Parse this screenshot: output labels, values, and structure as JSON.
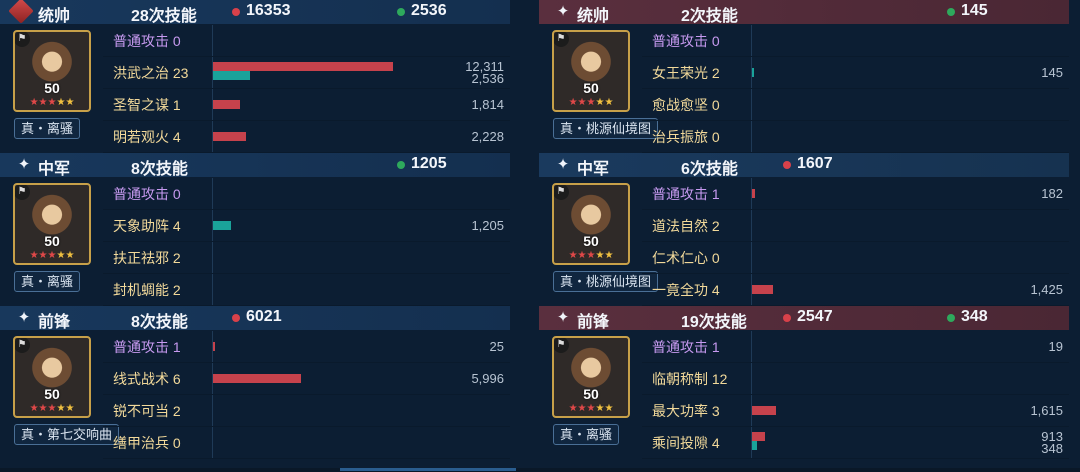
{
  "left": [
    {
      "role": "统帅",
      "icon": "red-diamond-badge-icon",
      "skill_count": "28次技能",
      "damage": "16353",
      "heal": "2536",
      "level": "50",
      "hero": "真・离骚",
      "skills": [
        {
          "name": "普通攻击",
          "count": "0",
          "basic": true,
          "bars": [],
          "values": []
        },
        {
          "name": "洪武之治",
          "count": "23",
          "basic": false,
          "bars": [
            {
              "kind": "damage",
              "value": 12311
            },
            {
              "kind": "heal",
              "value": 2536
            }
          ],
          "values": [
            "12,311",
            "2,536"
          ]
        },
        {
          "name": "圣智之谋",
          "count": "1",
          "basic": false,
          "bars": [
            {
              "kind": "damage",
              "value": 1814
            }
          ],
          "values": [
            "1,814"
          ]
        },
        {
          "name": "明若观火",
          "count": "4",
          "basic": false,
          "bars": [
            {
              "kind": "damage",
              "value": 2228
            }
          ],
          "values": [
            "2,228"
          ]
        }
      ]
    },
    {
      "role": "中军",
      "icon": "sparkle-icon",
      "skill_count": "8次技能",
      "damage": "",
      "heal": "1205",
      "level": "50",
      "hero": "真・离骚",
      "skills": [
        {
          "name": "普通攻击",
          "count": "0",
          "basic": true,
          "bars": [],
          "values": []
        },
        {
          "name": "天象助阵",
          "count": "4",
          "basic": false,
          "bars": [
            {
              "kind": "heal",
              "value": 1205
            }
          ],
          "values": [
            "1,205"
          ]
        },
        {
          "name": "扶正祛邪",
          "count": "2",
          "basic": false,
          "bars": [],
          "values": []
        },
        {
          "name": "封机蜩能",
          "count": "2",
          "basic": false,
          "bars": [],
          "values": []
        }
      ]
    },
    {
      "role": "前锋",
      "icon": "sparkle-icon",
      "skill_count": "8次技能",
      "damage": "6021",
      "heal": "",
      "level": "50",
      "hero": "真・第七交响曲",
      "skills": [
        {
          "name": "普通攻击",
          "count": "1",
          "basic": true,
          "bars": [
            {
              "kind": "damage",
              "value": 25
            }
          ],
          "values": [
            "25"
          ]
        },
        {
          "name": "线式战术",
          "count": "6",
          "basic": false,
          "bars": [
            {
              "kind": "damage",
              "value": 5996
            }
          ],
          "values": [
            "5,996"
          ]
        },
        {
          "name": "锐不可当",
          "count": "2",
          "basic": false,
          "bars": [],
          "values": []
        },
        {
          "name": "缮甲治兵",
          "count": "0",
          "basic": false,
          "bars": [],
          "values": []
        }
      ]
    }
  ],
  "right": [
    {
      "role": "统帅",
      "icon": "sparkle-icon",
      "skill_count": "2次技能",
      "damage": "",
      "heal": "145",
      "level": "50",
      "hero": "真・桃源仙境图",
      "skills": [
        {
          "name": "普通攻击",
          "count": "0",
          "basic": true,
          "bars": [],
          "values": []
        },
        {
          "name": "女王荣光",
          "count": "2",
          "basic": false,
          "bars": [
            {
              "kind": "heal",
              "value": 145
            }
          ],
          "values": [
            "145"
          ]
        },
        {
          "name": "愈战愈坚",
          "count": "0",
          "basic": false,
          "bars": [],
          "values": []
        },
        {
          "name": "治兵振旅",
          "count": "0",
          "basic": false,
          "bars": [],
          "values": []
        }
      ]
    },
    {
      "role": "中军",
      "icon": "sparkle-icon",
      "skill_count": "6次技能",
      "damage": "1607",
      "heal": "",
      "level": "50",
      "hero": "真・桃源仙境图",
      "skills": [
        {
          "name": "普通攻击",
          "count": "1",
          "basic": true,
          "bars": [
            {
              "kind": "damage",
              "value": 182
            }
          ],
          "values": [
            "182"
          ]
        },
        {
          "name": "道法自然",
          "count": "2",
          "basic": false,
          "bars": [],
          "values": []
        },
        {
          "name": "仁术仁心",
          "count": "0",
          "basic": false,
          "bars": [],
          "values": []
        },
        {
          "name": "一竟全功",
          "count": "4",
          "basic": false,
          "bars": [
            {
              "kind": "damage",
              "value": 1425
            }
          ],
          "values": [
            "1,425"
          ]
        }
      ]
    },
    {
      "role": "前锋",
      "icon": "sparkle-icon",
      "skill_count": "19次技能",
      "damage": "2547",
      "heal": "348",
      "level": "50",
      "hero": "真・离骚",
      "skills": [
        {
          "name": "普通攻击",
          "count": "1",
          "basic": true,
          "bars": [],
          "values": [
            "19"
          ]
        },
        {
          "name": "临朝称制",
          "count": "12",
          "basic": false,
          "bars": [],
          "values": []
        },
        {
          "name": "最大功率",
          "count": "3",
          "basic": false,
          "bars": [
            {
              "kind": "damage",
              "value": 1615
            }
          ],
          "values": [
            "1,615"
          ]
        },
        {
          "name": "乘间投隙",
          "count": "4",
          "basic": false,
          "bars": [
            {
              "kind": "damage",
              "value": 913
            },
            {
              "kind": "heal",
              "value": 348
            }
          ],
          "values": [
            "913",
            "348"
          ]
        }
      ]
    }
  ],
  "stars": {
    "red": "★★★",
    "gold": "★★"
  }
}
